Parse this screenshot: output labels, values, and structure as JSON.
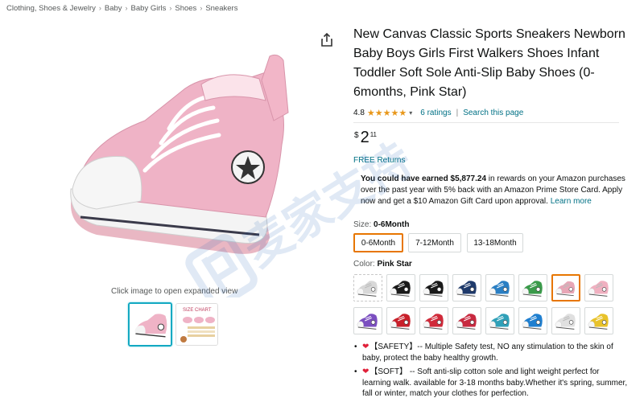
{
  "breadcrumb": [
    "Clothing, Shoes & Jewelry",
    "Baby",
    "Baby Girls",
    "Shoes",
    "Sneakers"
  ],
  "breadcrumb_separator": "›",
  "image": {
    "click_hint": "Click image to open expanded view",
    "size_chart_thumb_text": "SIZE CHART"
  },
  "product": {
    "title": "New Canvas Classic Sports Sneakers Newborn Baby Boys Girls First Walkers Shoes Infant Toddler Soft Sole Anti-Slip Baby Shoes (0-6months, Pink Star)",
    "rating": "4.8",
    "stars": "★★★★★",
    "ratings_link": "6 ratings",
    "pipe": "|",
    "search_link": "Search this page",
    "price_symbol": "$",
    "price_whole": "2",
    "price_fraction": "11",
    "free_returns": "FREE Returns"
  },
  "rewards": {
    "lead": "You could have earned",
    "amount": "$5,877.24",
    "body": "in rewards on your Amazon purchases over the past year with 5% back with an Amazon Prime Store Card. Apply now and get a $10 Amazon Gift Card upon approval.",
    "learn_more": "Learn more"
  },
  "size": {
    "label": "Size:",
    "selected": "0-6Month",
    "options": [
      "0-6Month",
      "7-12Month",
      "13-18Month"
    ]
  },
  "color": {
    "label": "Color:",
    "selected": "Pink Star",
    "swatch_colors": [
      "#d8d8d8",
      "#1a1a1a",
      "#1a1a1a",
      "#1f3a6b",
      "#2a7fc4",
      "#3a9a4a",
      "#e8a6b6",
      "#f0b0c0",
      "#7b4fc0",
      "#c8202a",
      "#d02a3a",
      "#c82a40",
      "#2fa0b8",
      "#1f7fd0",
      "#e0e0e0",
      "#e8c22a"
    ]
  },
  "bullets": [
    {
      "heart": "❤",
      "text": "【SAFETY】-- Multiple Safety test, NO any stimulation to the skin of baby, protect the baby healthy growth."
    },
    {
      "heart": "❤",
      "text": "【SOFT】 -- Soft anti-slip cotton sole and light weight perfect for learning walk. available for 3-18 months baby.Whether it's spring, summer, fall or winter, match your clothes for perfection."
    }
  ],
  "watermark": "麦家支持",
  "colors": {
    "link": "#007185",
    "star": "#e8971a",
    "selected_border": "#e77600",
    "thumb_selected": "#13a9c2"
  }
}
